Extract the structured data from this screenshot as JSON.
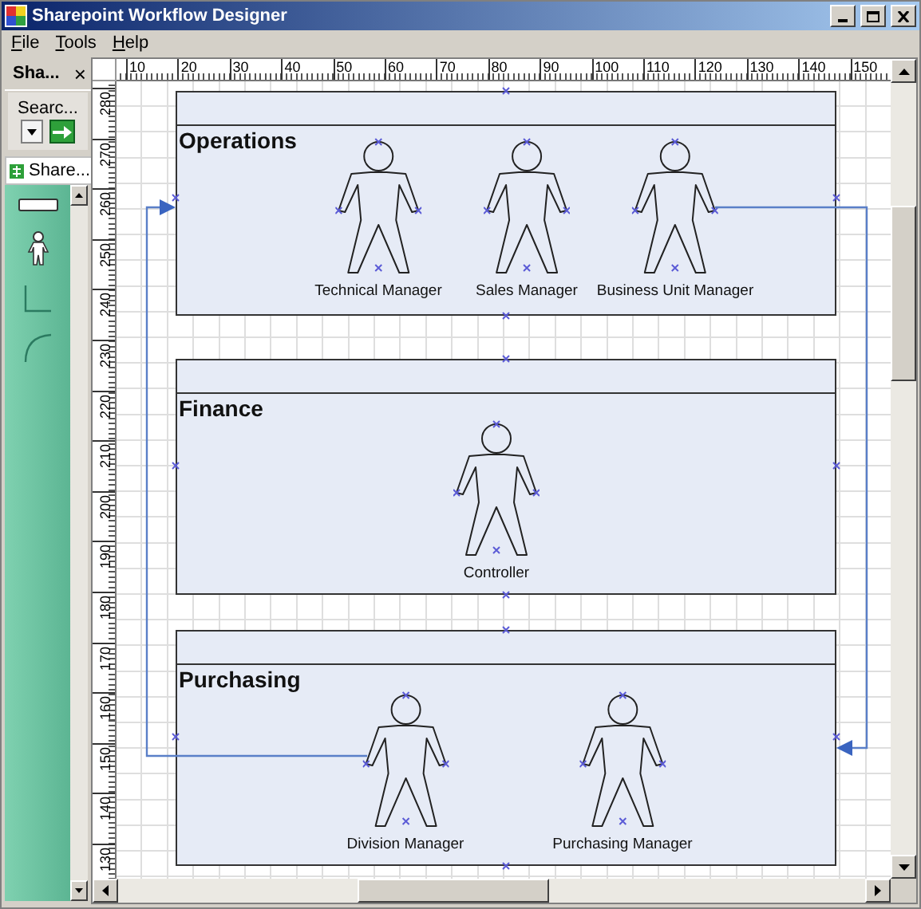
{
  "window": {
    "title": "Sharepoint Workflow Designer"
  },
  "menu": [
    {
      "label": "File"
    },
    {
      "label": "Tools"
    },
    {
      "label": "Help"
    }
  ],
  "shapes_panel": {
    "tab": "Sha...",
    "close": "×",
    "search_label": "Searc...",
    "stencil_tab": "Share..."
  },
  "rulers": {
    "horizontal": [
      "10",
      "20",
      "30",
      "40",
      "50",
      "60",
      "70",
      "80",
      "90",
      "100",
      "110",
      "120",
      "130",
      "140",
      "150"
    ],
    "vertical": [
      "280",
      "270",
      "260",
      "250",
      "240",
      "230",
      "220",
      "210",
      "200",
      "190",
      "180",
      "170",
      "160",
      "150",
      "140",
      "130"
    ]
  },
  "lanes": [
    {
      "title": "Operations",
      "actors": [
        {
          "name": "Technical Manager"
        },
        {
          "name": "Sales Manager"
        },
        {
          "name": "Business Unit Manager"
        }
      ]
    },
    {
      "title": "Finance",
      "actors": [
        {
          "name": "Controller"
        }
      ]
    },
    {
      "title": "Purchasing",
      "actors": [
        {
          "name": "Division Manager"
        },
        {
          "name": "Purchasing Manager"
        }
      ]
    }
  ]
}
